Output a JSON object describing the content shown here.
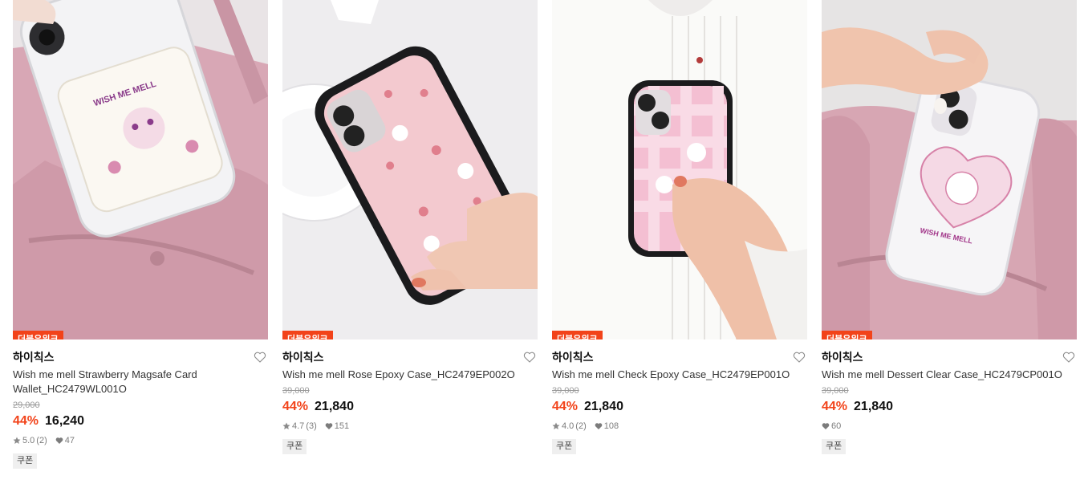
{
  "products": [
    {
      "badge": "더블유위크",
      "brand": "하이칙스",
      "name": "Wish me mell Strawberry Magsafe Card Wallet_HC2479WL001O",
      "original_price": "29,000",
      "discount": "44%",
      "price": "16,240",
      "rating": "5.0",
      "reviews": "(2)",
      "likes": "47",
      "coupon": "쿠폰",
      "image_icon": "phone-wallet-photo"
    },
    {
      "badge": "더블유위크",
      "brand": "하이칙스",
      "name": "Wish me mell Rose Epoxy Case_HC2479EP002O",
      "original_price": "39,000",
      "discount": "44%",
      "price": "21,840",
      "rating": "4.7",
      "reviews": "(3)",
      "likes": "151",
      "coupon": "쿠폰",
      "image_icon": "phone-case-photo"
    },
    {
      "badge": "더블유위크",
      "brand": "하이칙스",
      "name": "Wish me mell Check Epoxy Case_HC2479EP001O",
      "original_price": "39,000",
      "discount": "44%",
      "price": "21,840",
      "rating": "4.0",
      "reviews": "(2)",
      "likes": "108",
      "coupon": "쿠폰",
      "image_icon": "phone-case-photo"
    },
    {
      "badge": "더블유위크",
      "brand": "하이칙스",
      "name": "Wish me mell Dessert Clear Case_HC2479CP001O",
      "original_price": "39,000",
      "discount": "44%",
      "price": "21,840",
      "likes": "60",
      "coupon": "쿠폰",
      "image_icon": "phone-case-photo"
    }
  ],
  "colors": {
    "accent": "#f2431a",
    "pink_bag": "#d9a9b6",
    "muted": "#9a9a9a"
  }
}
